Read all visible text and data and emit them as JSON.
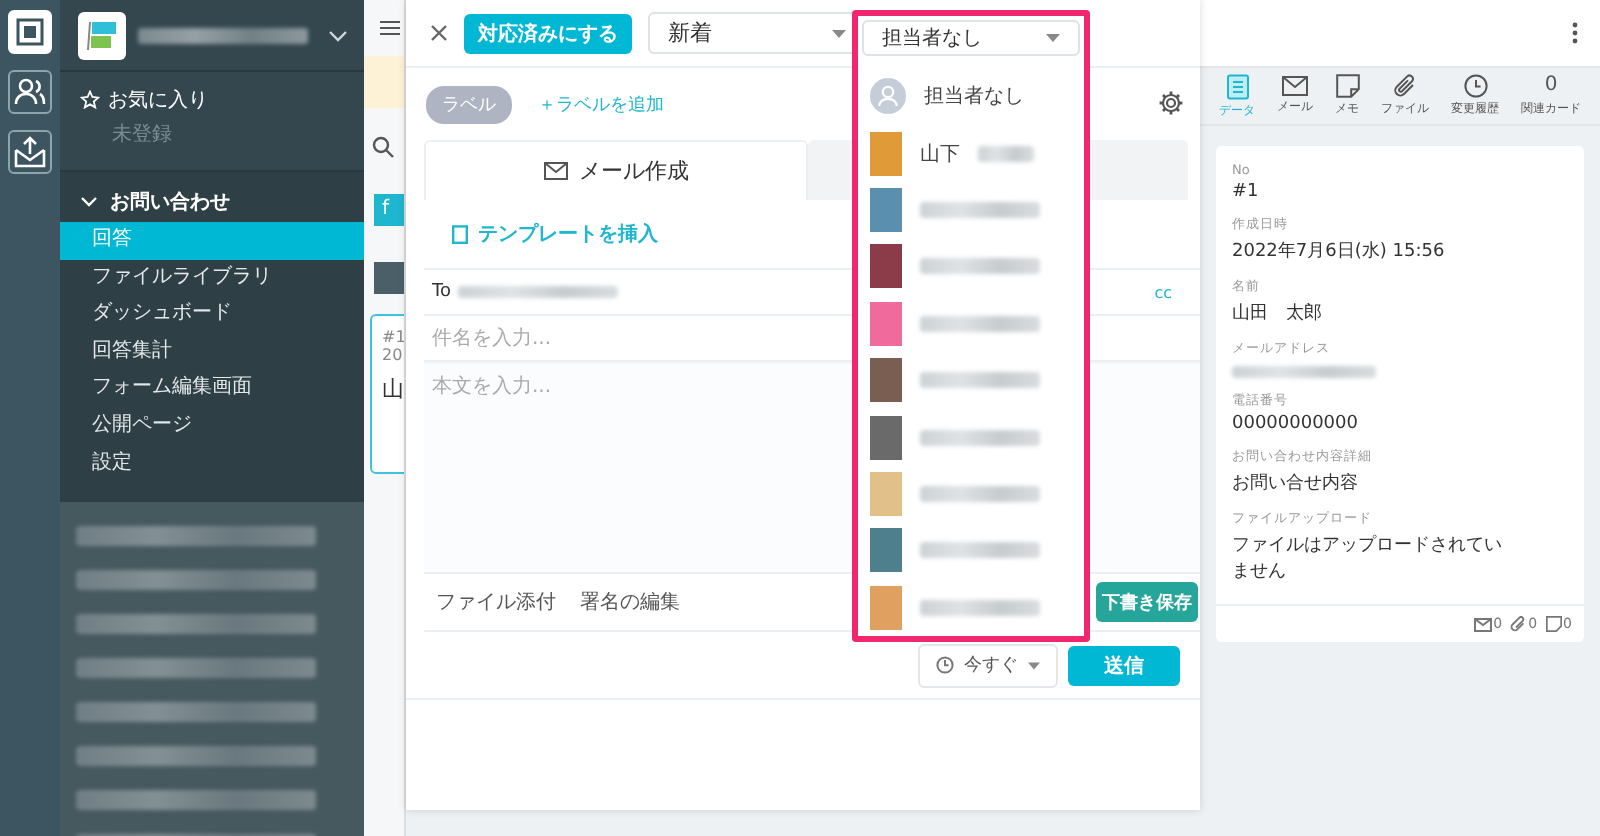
{
  "rail": {
    "items": [
      {
        "kind": "app",
        "selected": true
      },
      {
        "kind": "users",
        "selected": false
      },
      {
        "kind": "inbox",
        "selected": false
      }
    ]
  },
  "sidebar": {
    "favorites": {
      "title": "お気に入り",
      "empty": "未登録"
    },
    "group": {
      "title": "お問い合わせ",
      "expanded": true,
      "items": [
        {
          "label": "回答",
          "selected": true
        },
        {
          "label": "ファイルライブラリ",
          "selected": false
        },
        {
          "label": "ダッシュボード",
          "selected": false
        },
        {
          "label": "回答集計",
          "selected": false
        },
        {
          "label": "フォーム編集画面",
          "selected": false
        },
        {
          "label": "公開ページ",
          "selected": false
        },
        {
          "label": "設定",
          "selected": false
        }
      ]
    }
  },
  "list": {
    "tags": [
      {
        "label": "f",
        "color": "#1fb6d0"
      },
      {
        "color": "#4b5f68"
      }
    ],
    "card": {
      "no": "#1",
      "date": "20",
      "name": "山"
    }
  },
  "toolbar": {
    "done_button": "対応済みにする",
    "status": {
      "value": "新着"
    },
    "assignee": {
      "value": "担当者なし",
      "open": true
    }
  },
  "assignee_menu": [
    {
      "kind": "none",
      "name": "担当者なし"
    },
    {
      "kind": "user",
      "name": "山下",
      "color": "#e09a38"
    },
    {
      "kind": "user",
      "color": "#5a8fae"
    },
    {
      "kind": "user",
      "color": "#8c3c48"
    },
    {
      "kind": "user",
      "color": "#f06a9c"
    },
    {
      "kind": "user",
      "color": "#7a5e52"
    },
    {
      "kind": "user",
      "color": "#6a6a6a"
    },
    {
      "kind": "user",
      "color": "#e2c08a"
    },
    {
      "kind": "user",
      "color": "#4e7f8c"
    },
    {
      "kind": "user",
      "color": "#e0a060"
    }
  ],
  "labels": {
    "label": "ラベル",
    "add": "＋ラベルを追加"
  },
  "compose": {
    "tabs": [
      {
        "label": "メール作成",
        "selected": true
      },
      {
        "selected": false
      }
    ],
    "template_link": "テンプレートを挿入",
    "to_label": "To",
    "cc": "cc",
    "subject_placeholder": "件名を入力...",
    "body_placeholder": "本文を入力...",
    "attach": "ファイル添付",
    "signature": "署名の編集",
    "draft": "下書き保存",
    "schedule": "今すぐ",
    "send": "送信"
  },
  "detail": {
    "tabs": [
      {
        "kind": "data",
        "label": "データ",
        "selected": true
      },
      {
        "kind": "mail",
        "label": "メール",
        "selected": false
      },
      {
        "kind": "memo",
        "label": "メモ",
        "selected": false
      },
      {
        "kind": "file",
        "label": "ファイル",
        "selected": false
      },
      {
        "kind": "history",
        "label": "変更履歴",
        "selected": false
      },
      {
        "kind": "count",
        "count": "0",
        "label": "関連カード",
        "selected": false
      }
    ],
    "fields": [
      {
        "label": "No",
        "value": "#1"
      },
      {
        "label": "作成日時",
        "value": "2022年7月6日(水) 15:56"
      },
      {
        "label": "名前",
        "value": "山田　太郎"
      },
      {
        "label": "メールアドレス"
      },
      {
        "label": "電話番号",
        "value": "00000000000"
      },
      {
        "label": "お問い合わせ内容詳細",
        "value": "お問い合せ内容"
      },
      {
        "label": "ファイルアップロード",
        "value": "ファイルはアップロードされていません"
      }
    ],
    "footer": [
      {
        "kind": "mail",
        "count": "0"
      },
      {
        "kind": "file",
        "count": "0"
      },
      {
        "kind": "memo",
        "count": "0"
      }
    ]
  }
}
